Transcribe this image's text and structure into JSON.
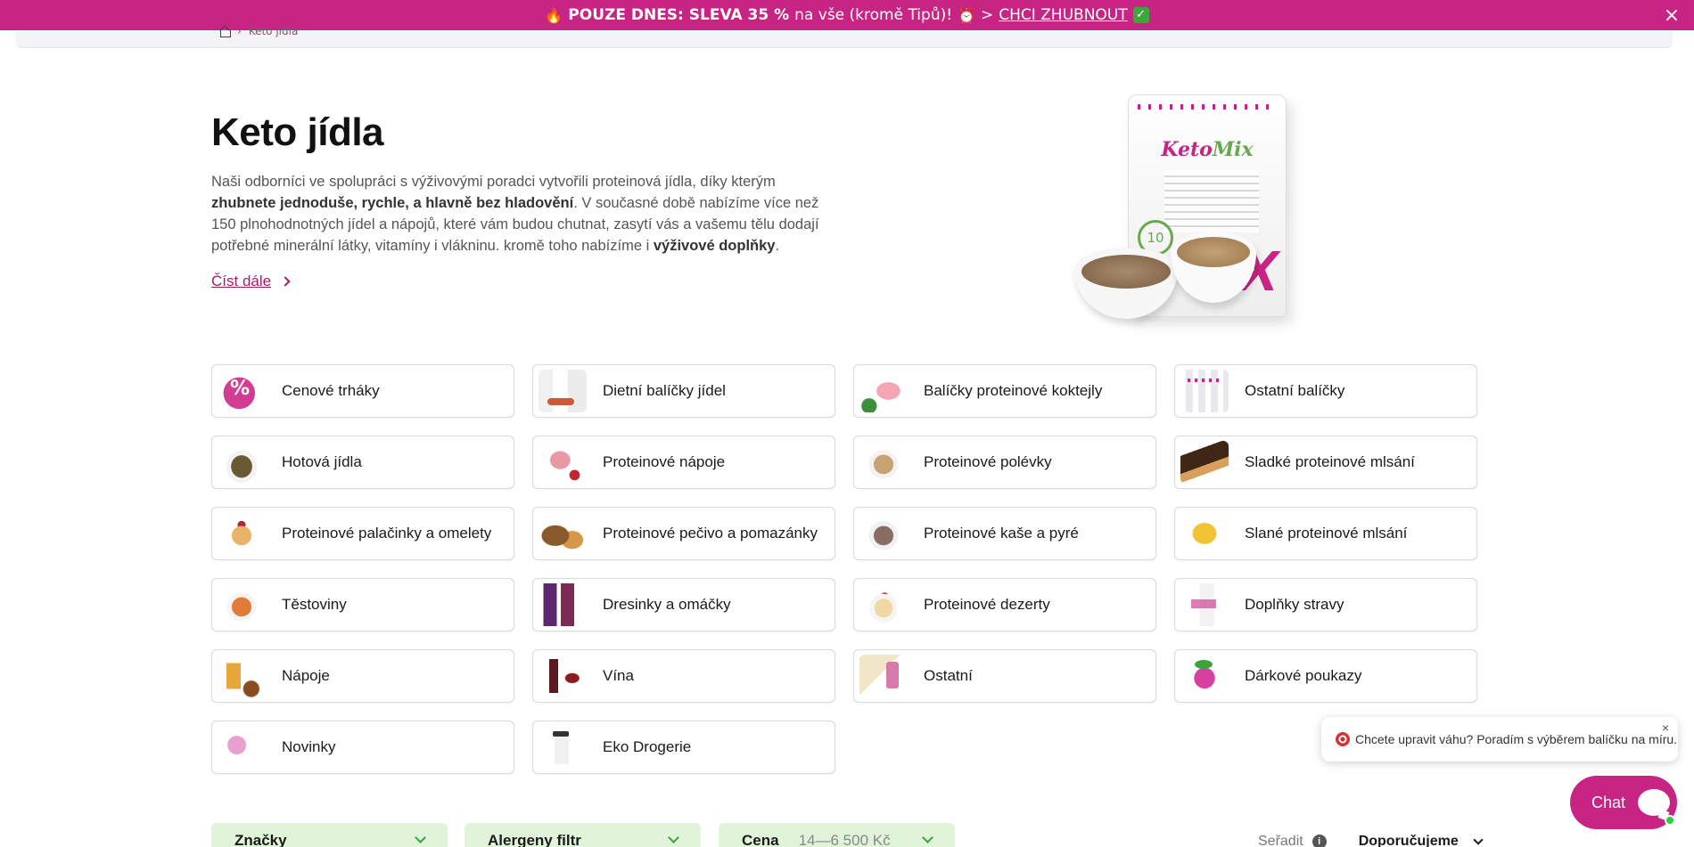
{
  "promo": {
    "fire": "🔥",
    "bold": "POUZE DNES: SLEVA 35 %",
    "rest": "na vše (kromě Tipů)!",
    "alarm": "⏰",
    "arrow": ">",
    "cta": "CHCI ZHUBNOUT",
    "check": "✓",
    "close": "×"
  },
  "breadcrumb": {
    "current": "Keto jídla"
  },
  "hero": {
    "title": "Keto jídla",
    "p1": "Naši odborníci ve spolupráci s výživovými poradci vytvořili proteinová jídla, díky kterým ",
    "b1": "zhubnete jednoduše, rychle, a hlavně bez hladovění",
    "p2": ". V současné době nabízíme více než 150 plnohodnotných jídel a nápojů, které vám budou chutnat, zasytí vás a vašemu tělu dodají potřebné minerální látky, vitamíny i vlákninu. kromě toho nabízíme i ",
    "b2": "výživové doplňky",
    "p3": ".",
    "read_more": "Číst dále"
  },
  "product_image": {
    "brand_a": "Keto",
    "brand_b": "Mix",
    "portions": "10",
    "mark": "X"
  },
  "categories": [
    {
      "label": "Cenové trháky",
      "thumb": "t-sale"
    },
    {
      "label": "Dietní balíčky jídel",
      "thumb": "t-pack"
    },
    {
      "label": "Balíčky proteinové koktejly",
      "thumb": "t-shake"
    },
    {
      "label": "Ostatní balíčky",
      "thumb": "t-other"
    },
    {
      "label": "Hotová jídla",
      "thumb": "t-meal"
    },
    {
      "label": "Proteinové nápoje",
      "thumb": "t-drink"
    },
    {
      "label": "Proteinové polévky",
      "thumb": "t-soup"
    },
    {
      "label": "Sladké proteinové mlsání",
      "thumb": "t-sweet"
    },
    {
      "label": "Proteinové palačinky a omelety",
      "thumb": "t-pancake"
    },
    {
      "label": "Proteinové pečivo a pomazánky",
      "thumb": "t-bread"
    },
    {
      "label": "Proteinové kaše a pyré",
      "thumb": "t-porridge"
    },
    {
      "label": "Slané proteinové mlsání",
      "thumb": "t-chips"
    },
    {
      "label": "Těstoviny",
      "thumb": "t-pasta"
    },
    {
      "label": "Dresinky a omáčky",
      "thumb": "t-sauce"
    },
    {
      "label": "Proteinové dezerty",
      "thumb": "t-dessert"
    },
    {
      "label": "Doplňky stravy",
      "thumb": "t-supp"
    },
    {
      "label": "Nápoje",
      "thumb": "t-bev"
    },
    {
      "label": "Vína",
      "thumb": "t-wine"
    },
    {
      "label": "Ostatní",
      "thumb": "t-misc"
    },
    {
      "label": "Dárkové poukazy",
      "thumb": "t-gift"
    },
    {
      "label": "Novinky",
      "thumb": "t-new"
    },
    {
      "label": "Eko Drogerie",
      "thumb": "t-eko"
    }
  ],
  "chat": {
    "message": "Chcete upravit váhu? Poradím s výběrem balíčku na míru.",
    "close": "×",
    "button": "Chat"
  },
  "filters": {
    "brands": "Značky",
    "allergens": "Alergeny filtr",
    "price": "Cena",
    "price_range": "14—6 500 Kč"
  },
  "sort": {
    "label": "Seřadit",
    "info": "i",
    "value": "Doporučujeme"
  }
}
